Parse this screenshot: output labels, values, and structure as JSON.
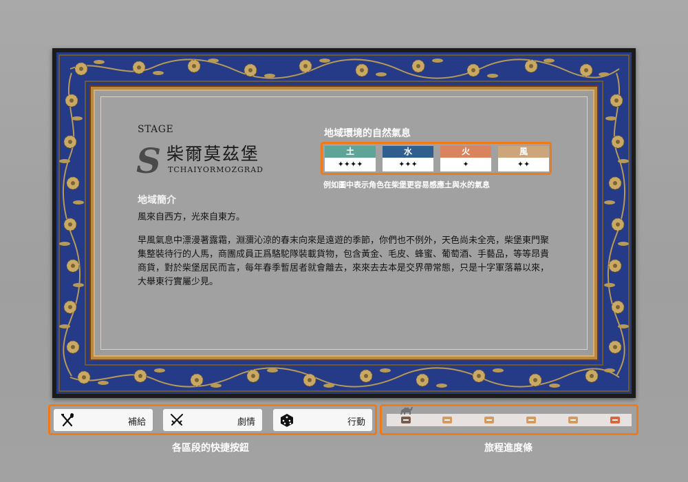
{
  "stage": {
    "label": "STAGE",
    "monogram": "S",
    "name": "柴爾莫茲堡",
    "roman": "TCHAIYORMOZGRAD"
  },
  "intro": {
    "title": "地域簡介",
    "subtitle": "風來自西方，光來自東方。",
    "description": "早風氣息中漂漫著露霜，淵瀰沁涼的春末向來是遠遊的季節，你們也不例外，天色尚未全亮，柴堡東門聚集整裝待行的人馬，商團成員正爲駱駝隊裝載貨物，包含黃金、毛皮、蜂蜜、葡萄酒、手藝品，等等昂貴商貨，對於柴堡居民而言，每年春季暫居者就會離去，來來去去本是交界帶常態，只是十字軍落幕以來，大舉東行實屬少見。"
  },
  "environment": {
    "title": "地域環境的自然氣息",
    "note": "例如圖中表示角色在柴堡更容易感應土與水的氣息",
    "elements": [
      {
        "name": "土",
        "stars": "✦✦✦✦",
        "color": "#5fa597"
      },
      {
        "name": "水",
        "stars": "✦✦✦",
        "color": "#2f5f8f"
      },
      {
        "name": "火",
        "stars": "✦",
        "color": "#d9845e"
      },
      {
        "name": "風",
        "stars": "✦✦",
        "color": "#cda57a"
      }
    ]
  },
  "quick_buttons": {
    "caption": "各區段的快捷按鈕",
    "items": [
      {
        "label": "補給",
        "icon": "fork-knife-icon"
      },
      {
        "label": "劇情",
        "icon": "crossed-swords-icon"
      },
      {
        "label": "行動",
        "icon": "dice-icon"
      }
    ]
  },
  "progress": {
    "caption": "旅程進度條",
    "total_nodes": 6,
    "current_node": 1,
    "marker_icon": "camel-icon"
  },
  "colors": {
    "accent": "#f07a17",
    "frame_blue": "#243a86",
    "frame_gold": "#b8893f"
  }
}
